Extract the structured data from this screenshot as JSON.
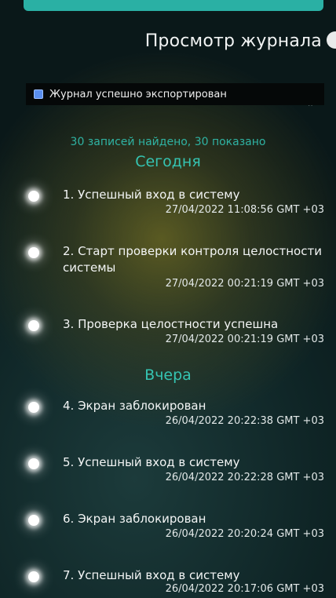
{
  "header": {
    "title": "Просмотр журнала"
  },
  "toast": {
    "icon": "document-icon",
    "message": "Журнал успешно экспортирован"
  },
  "summary": "30 записей найдено, 30 показано",
  "sections": [
    {
      "label": "Сегодня"
    },
    {
      "label": "Вчера"
    }
  ],
  "entries": [
    {
      "title": "1. Успешный вход в систему",
      "timestamp": "27/04/2022 11:08:56 GMT +03"
    },
    {
      "title": "2. Старт проверки контроля целостности системы",
      "timestamp": "27/04/2022 00:21:19 GMT +03"
    },
    {
      "title": "3. Проверка целостности успешна",
      "timestamp": "27/04/2022 00:21:19 GMT +03"
    },
    {
      "title": "4. Экран заблокирован",
      "timestamp": "26/04/2022 20:22:38 GMT +03"
    },
    {
      "title": "5. Успешный вход в систему",
      "timestamp": "26/04/2022 20:22:28 GMT +03"
    },
    {
      "title": "6. Экран заблокирован",
      "timestamp": "26/04/2022 20:20:24 GMT +03"
    },
    {
      "title": "7. Успешный вход в систему",
      "timestamp": "26/04/2022 20:17:06 GMT +03"
    }
  ]
}
